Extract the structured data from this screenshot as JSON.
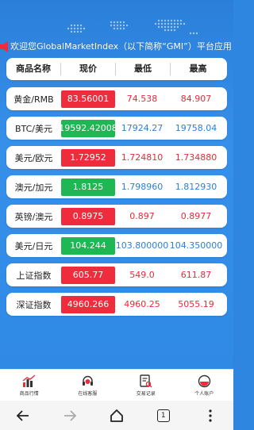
{
  "marquee": {
    "text": "欢迎您GlobalMarketIndex（以下简称“GMI”）平台应用"
  },
  "table": {
    "headers": [
      "商品名称",
      "现价",
      "最低",
      "最高"
    ],
    "rows": [
      {
        "name": "黄金/RMB",
        "price": "83.56001",
        "low": "74.538",
        "high": "84.907",
        "dir": "up",
        "color": "red"
      },
      {
        "name": "BTC/美元",
        "price": "19592.42008",
        "low": "17924.27",
        "high": "19758.04",
        "dir": "down",
        "color": "blue"
      },
      {
        "name": "美元/欧元",
        "price": "1.72952",
        "low": "1.724810",
        "high": "1.734880",
        "dir": "up",
        "color": "red"
      },
      {
        "name": "澳元/加元",
        "price": "1.8125",
        "low": "1.798960",
        "high": "1.812930",
        "dir": "down",
        "color": "blue"
      },
      {
        "name": "英镑/澳元",
        "price": "0.8975",
        "low": "0.897",
        "high": "0.8977",
        "dir": "up",
        "color": "red"
      },
      {
        "name": "美元/日元",
        "price": "104.244",
        "low": "103.800000",
        "high": "104.350000",
        "dir": "down",
        "color": "blue"
      },
      {
        "name": "上证指数",
        "price": "605.77",
        "low": "549.0",
        "high": "611.87",
        "dir": "up",
        "color": "red"
      },
      {
        "name": "深证指数",
        "price": "4960.266",
        "low": "4960.25",
        "high": "5055.19",
        "dir": "up",
        "color": "red"
      }
    ]
  },
  "bottom_nav": {
    "items": [
      {
        "label": "商品行情",
        "icon": "chart-icon"
      },
      {
        "label": "在线客服",
        "icon": "headset-icon"
      },
      {
        "label": "交易记录",
        "icon": "record-icon"
      },
      {
        "label": "个人账户",
        "icon": "account-icon"
      }
    ]
  },
  "browser": {
    "tab_count": "1"
  },
  "colors": {
    "up": "#ee2c3c",
    "down": "#1fb754",
    "red_text": "#e82a3a",
    "blue_text": "#2b7fd9",
    "background": "#2f86e0"
  }
}
